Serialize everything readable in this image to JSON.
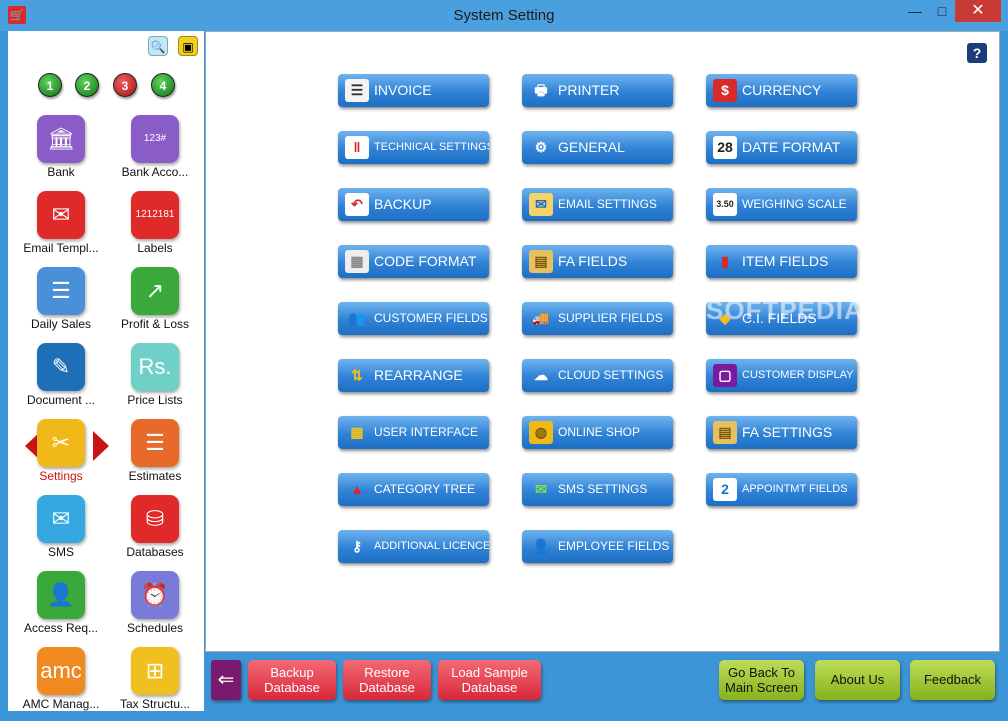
{
  "window": {
    "title": "System Setting",
    "minimize": "—",
    "maximize": "□",
    "close": "✕"
  },
  "sidebar": {
    "top_icons": [
      "search-icon",
      "windows-icon"
    ],
    "numbers": [
      "1",
      "2",
      "3",
      "4"
    ],
    "items": [
      {
        "label": "Bank",
        "glyph": "🏛",
        "color": "#8a5cc7"
      },
      {
        "label": "Bank Acco...",
        "glyph": "123#",
        "color": "#8a5cc7"
      },
      {
        "label": "Email Templ...",
        "glyph": "✉",
        "color": "#e02a2a"
      },
      {
        "label": "Labels",
        "glyph": "1212181",
        "color": "#e02a2a"
      },
      {
        "label": "Daily Sales",
        "glyph": "☰",
        "color": "#4a90d9"
      },
      {
        "label": "Profit & Loss",
        "glyph": "↗",
        "color": "#3aa83a"
      },
      {
        "label": "Document ...",
        "glyph": "✎",
        "color": "#1f6fb8"
      },
      {
        "label": "Price Lists",
        "glyph": "Rs.",
        "color": "#6fd0c8"
      },
      {
        "label": "Settings",
        "glyph": "✂",
        "color": "#f0b818"
      },
      {
        "label": "Estimates",
        "glyph": "☰",
        "color": "#e86a2a"
      },
      {
        "label": "SMS",
        "glyph": "✉",
        "color": "#35a8e0"
      },
      {
        "label": "Databases",
        "glyph": "⛁",
        "color": "#e02a2a"
      },
      {
        "label": "Access Req...",
        "glyph": "👤",
        "color": "#3aa83a"
      },
      {
        "label": "Schedules",
        "glyph": "⏰",
        "color": "#7a7ad8"
      },
      {
        "label": "AMC Manag...",
        "glyph": "amc",
        "color": "#f08a20"
      },
      {
        "label": "Tax Structu...",
        "glyph": "⊞",
        "color": "#f0c020"
      }
    ]
  },
  "settings_buttons": [
    {
      "label": "INVOICE",
      "glyph": "☰",
      "icon_bg": "#f4f4f4",
      "icon_fg": "#333",
      "size": ""
    },
    {
      "label": "PRINTER",
      "glyph": "🖶",
      "icon_bg": "transparent",
      "icon_fg": "#fff",
      "size": ""
    },
    {
      "label": "CURRENCY",
      "glyph": "$",
      "icon_bg": "#d92a2a",
      "icon_fg": "#fff",
      "size": ""
    },
    {
      "label": "TECHNICAL SETTINGS",
      "glyph": "‖",
      "icon_bg": "#fff",
      "icon_fg": "#d92a2a",
      "size": "xs"
    },
    {
      "label": "GENERAL",
      "glyph": "⚙",
      "icon_bg": "transparent",
      "icon_fg": "#fff",
      "size": ""
    },
    {
      "label": "DATE FORMAT",
      "glyph": "28",
      "icon_bg": "#fff",
      "icon_fg": "#222",
      "size": ""
    },
    {
      "label": "BACKUP",
      "glyph": "↶",
      "icon_bg": "#fff",
      "icon_fg": "#d92a2a",
      "size": ""
    },
    {
      "label": "EMAIL SETTINGS",
      "glyph": "✉",
      "icon_bg": "#f6d36a",
      "icon_fg": "#1e6fc4",
      "size": "sm"
    },
    {
      "label": "WEIGHING SCALE",
      "glyph": "3.50",
      "icon_bg": "#fff",
      "icon_fg": "#222",
      "size": "sm"
    },
    {
      "label": "CODE FORMAT",
      "glyph": "▦",
      "icon_bg": "#eee",
      "icon_fg": "#888",
      "size": ""
    },
    {
      "label": "FA FIELDS",
      "glyph": "▤",
      "icon_bg": "#e8c060",
      "icon_fg": "#7a5a10",
      "size": ""
    },
    {
      "label": "ITEM FIELDS",
      "glyph": "▮",
      "icon_bg": "transparent",
      "icon_fg": "#d92a2a",
      "size": ""
    },
    {
      "label": "CUSTOMER FIELDS",
      "glyph": "👥",
      "icon_bg": "transparent",
      "icon_fg": "#f0c020",
      "size": "sm"
    },
    {
      "label": "SUPPLIER FIELDS",
      "glyph": "🚚",
      "icon_bg": "transparent",
      "icon_fg": "#d92a2a",
      "size": "sm"
    },
    {
      "label": "C.I. FIELDS",
      "glyph": "◆",
      "icon_bg": "transparent",
      "icon_fg": "#f0c020",
      "size": ""
    },
    {
      "label": "REARRANGE",
      "glyph": "⇅",
      "icon_bg": "transparent",
      "icon_fg": "#f0c020",
      "size": ""
    },
    {
      "label": "CLOUD SETTINGS",
      "glyph": "☁",
      "icon_bg": "transparent",
      "icon_fg": "#fff",
      "size": "sm"
    },
    {
      "label": "CUSTOMER DISPLAY",
      "glyph": "▢",
      "icon_bg": "#7a1a9e",
      "icon_fg": "#fff",
      "size": "xs"
    },
    {
      "label": "USER INTERFACE",
      "glyph": "▦",
      "icon_bg": "transparent",
      "icon_fg": "#f0c020",
      "size": "sm"
    },
    {
      "label": "ONLINE SHOP",
      "glyph": "◍",
      "icon_bg": "#f0b818",
      "icon_fg": "#7a5a10",
      "size": "sm"
    },
    {
      "label": "FA SETTINGS",
      "glyph": "▤",
      "icon_bg": "#e8c060",
      "icon_fg": "#7a5a10",
      "size": ""
    },
    {
      "label": "CATEGORY TREE",
      "glyph": "▲",
      "icon_bg": "transparent",
      "icon_fg": "#d92a2a",
      "size": "sm"
    },
    {
      "label": "SMS SETTINGS",
      "glyph": "✉",
      "icon_bg": "transparent",
      "icon_fg": "#7adf4a",
      "size": "sm"
    },
    {
      "label": "APPOINTMT FIELDS",
      "glyph": "2",
      "icon_bg": "#fff",
      "icon_fg": "#1e6fc4",
      "size": "xs"
    },
    {
      "label": "ADDITIONAL LICENCES",
      "glyph": "⚷",
      "icon_bg": "transparent",
      "icon_fg": "#fff",
      "size": "xs"
    },
    {
      "label": "EMPLOYEE FIELDS",
      "glyph": "👤",
      "icon_bg": "transparent",
      "icon_fg": "#fff",
      "size": "sm"
    }
  ],
  "help_label": "?",
  "watermark": "SOFTPEDIA",
  "bottom": {
    "back_glyph": "⇐",
    "backup_database": "Backup Database",
    "restore_database": "Restore Database",
    "load_sample_database": "Load Sample Database",
    "go_back": "Go Back To Main Screen",
    "about_us": "About Us",
    "feedback": "Feedback"
  }
}
